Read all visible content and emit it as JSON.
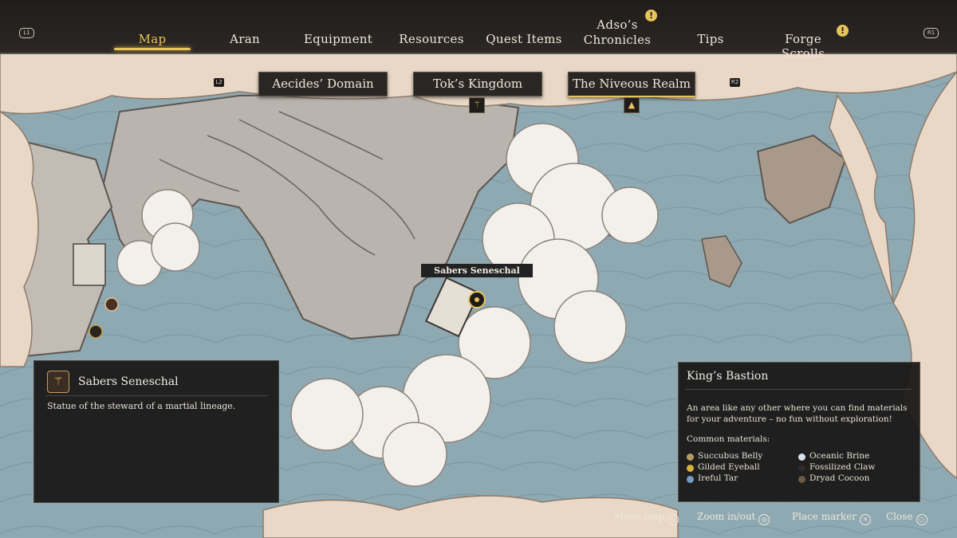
{
  "top_tabs": {
    "map": "Map",
    "aran": "Aran",
    "equipment": "Equipment",
    "resources": "Resources",
    "quest_items": "Quest Items",
    "chronicles_line1": "Adso’s",
    "chronicles_line2": "Chronicles",
    "tips": "Tips",
    "forge_scrolls": "Forge Scrolls",
    "alert_glyph": "!",
    "left_shoulder": "L1",
    "right_shoulder": "R1"
  },
  "regions": {
    "aecides": "Aecides’ Domain",
    "toks": "Tok’s Kingdom",
    "niveous": "The Niveous Realm",
    "left_key": "L2",
    "right_key": "R2"
  },
  "map": {
    "marker_label": "Sabers Seneschal"
  },
  "left_panel": {
    "title": "Sabers Seneschal",
    "description": "Statue of the steward of a martial lineage."
  },
  "right_panel": {
    "title": "King’s Bastion",
    "description": "An area like any other where you can find materials for your adventure – no fun without exploration!",
    "common_materials_label": "Common materials:",
    "materials": [
      {
        "name": "Succubus Belly",
        "color": "#b69a63"
      },
      {
        "name": "Gilded Eyeball",
        "color": "#d8b23f"
      },
      {
        "name": "Ireful Tar",
        "color": "#7a9cc4"
      },
      {
        "name": "Oceanic Brine",
        "color": "#d9e3ea"
      },
      {
        "name": "Fossilized Claw",
        "color": "#2d2a28"
      },
      {
        "name": "Dryad Cocoon",
        "color": "#6b5a45"
      }
    ]
  },
  "bottom_prompts": {
    "move_map": "Move map",
    "zoom": "Zoom in/out",
    "place_marker": "Place marker",
    "close": "Close",
    "cross_glyph": "✕"
  },
  "colors": {
    "accent": "#e8c25a",
    "panel_bg": "#181615",
    "sea": "#8aa4ae",
    "parchment": "#e9dccd",
    "land": "#b9b4ad"
  }
}
